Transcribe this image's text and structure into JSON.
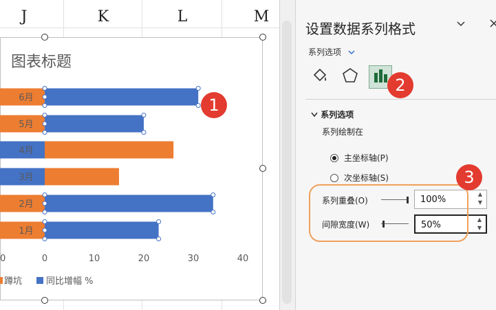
{
  "sheet": {
    "columns": [
      "J",
      "K",
      "L",
      "M"
    ]
  },
  "chart": {
    "title": "图表标题",
    "legend": [
      {
        "label": "蹲坑",
        "color": "#ed7d31"
      },
      {
        "label": "同比增幅 %",
        "color": "#4472c4"
      }
    ]
  },
  "chart_data": {
    "type": "bar",
    "orientation": "horizontal",
    "categories": [
      "1月",
      "2月",
      "3月",
      "4月",
      "5月",
      "6月"
    ],
    "series": [
      {
        "name": "同比增幅 %",
        "color": "#4472c4",
        "values": [
          23,
          34,
          null,
          null,
          20,
          31
        ]
      },
      {
        "name": "蹲坑",
        "color": "#ed7d31",
        "values": [
          null,
          null,
          15,
          26,
          null,
          null
        ]
      }
    ],
    "xticks": [
      "0",
      "10",
      "20",
      "30",
      "40"
    ],
    "xlim": [
      0,
      40
    ]
  },
  "panel": {
    "title": "设置数据系列格式",
    "dropdown_label": "系列选项",
    "section_header": "系列选项",
    "plot_on_label": "系列绘制在",
    "primary_axis": "主坐标轴(P)",
    "secondary_axis": "次坐标轴(S)",
    "overlap_label": "系列重叠(O)",
    "overlap_value": "100%",
    "gap_label": "间隙宽度(W)",
    "gap_value": "50%"
  },
  "annotations": [
    "1",
    "2",
    "3"
  ],
  "colors": {
    "badge": "#e33b2f",
    "highlight": "#f0a05a",
    "blue": "#4472c4",
    "orange": "#ed7d31"
  }
}
